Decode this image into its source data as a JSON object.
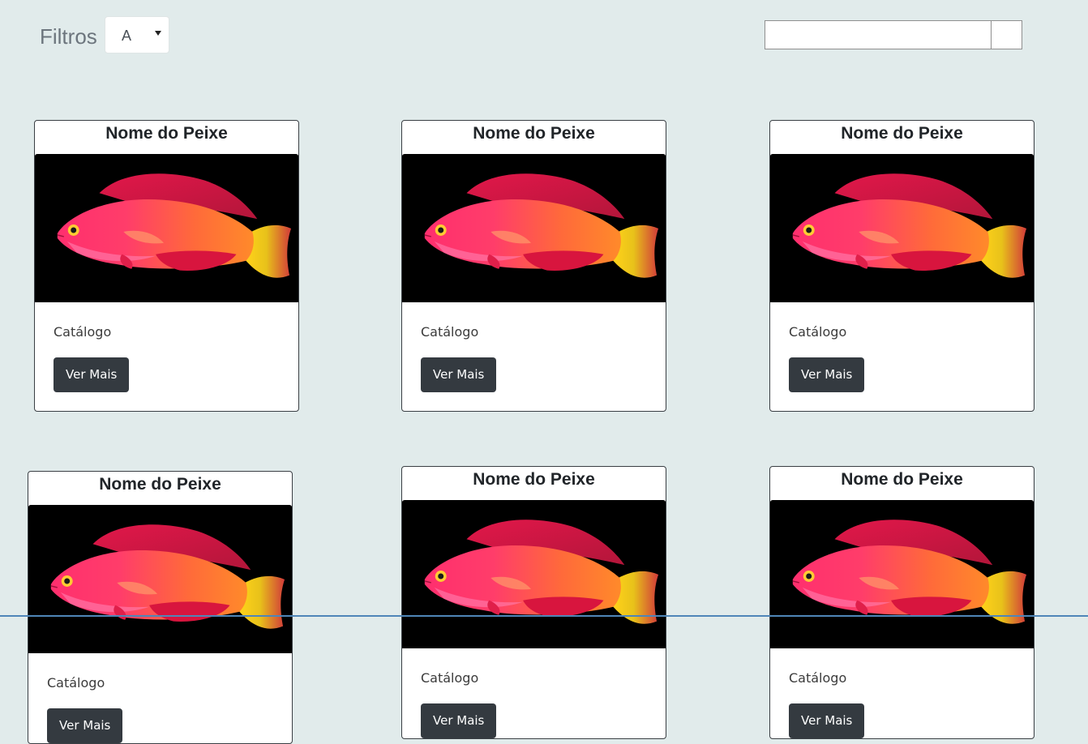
{
  "toolbar": {
    "filter_label": "Filtros",
    "filter_selected": "A",
    "search_value": "",
    "search_button_label": ""
  },
  "colors": {
    "page_background": "#e1ebeb",
    "button_dark": "#343a40",
    "image_background": "#000000"
  },
  "cards": [
    {
      "title": "Nome do Peixe",
      "text": "Catálogo",
      "button": "Ver Mais"
    },
    {
      "title": "Nome do Peixe",
      "text": "Catálogo",
      "button": "Ver Mais"
    },
    {
      "title": "Nome do Peixe",
      "text": "Catálogo",
      "button": "Ver Mais"
    },
    {
      "title": "Nome do Peixe",
      "text": "Catálogo",
      "button": "Ver Mais"
    },
    {
      "title": "Nome do Peixe",
      "text": "Catálogo",
      "button": "Ver Mais"
    },
    {
      "title": "Nome do Peixe",
      "text": "Catálogo",
      "button": "Ver Mais"
    }
  ]
}
